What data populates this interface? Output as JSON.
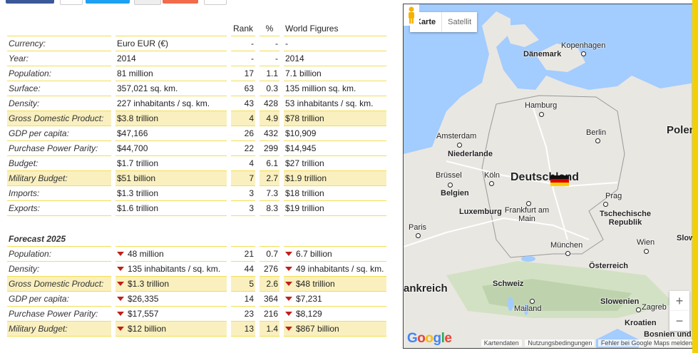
{
  "columns": {
    "rank": "Rank",
    "pct": "%",
    "world": "World Figures"
  },
  "rows": [
    {
      "label": "Currency:",
      "value": "Euro EUR (€)",
      "rank": "-",
      "pct": "-",
      "world": "-",
      "hl": false
    },
    {
      "label": "Year:",
      "value": "2014",
      "rank": "-",
      "pct": "-",
      "world": "2014",
      "hl": false
    },
    {
      "label": "Population:",
      "value": "81 million",
      "rank": "17",
      "pct": "1.1",
      "world": "7.1 billion",
      "hl": false
    },
    {
      "label": "Surface:",
      "value": "357,021 sq. km.",
      "rank": "63",
      "pct": "0.3",
      "world": "135 million sq. km.",
      "hl": false
    },
    {
      "label": "Density:",
      "value": "227 inhabitants / sq. km.",
      "rank": "43",
      "pct": "428",
      "world": "53 inhabitants / sq. km.",
      "hl": false
    },
    {
      "label": "Gross Domestic Product:",
      "value": "$3.8 trillion",
      "rank": "4",
      "pct": "4.9",
      "world": "$78 trillion",
      "hl": true
    },
    {
      "label": "GDP per capita:",
      "value": "$47,166",
      "rank": "26",
      "pct": "432",
      "world": "$10,909",
      "hl": false
    },
    {
      "label": "Purchase Power Parity:",
      "value": "$44,700",
      "rank": "22",
      "pct": "299",
      "world": "$14,945",
      "hl": false
    },
    {
      "label": "Budget:",
      "value": "$1.7 trillion",
      "rank": "4",
      "pct": "6.1",
      "world": "$27 trillion",
      "hl": false
    },
    {
      "label": "Military Budget:",
      "value": "$51 billion",
      "rank": "7",
      "pct": "2.7",
      "world": "$1.9 trillion",
      "hl": true
    },
    {
      "label": "Imports:",
      "value": "$1.3 trillion",
      "rank": "3",
      "pct": "7.3",
      "world": "$18 trillion",
      "hl": false
    },
    {
      "label": "Exports:",
      "value": "$1.6 trillion",
      "rank": "3",
      "pct": "8.3",
      "world": "$19 trillion",
      "hl": false
    }
  ],
  "forecast_title": "Forecast 2025",
  "forecast": [
    {
      "label": "Population:",
      "value": "48 million",
      "rank": "21",
      "pct": "0.7",
      "world": "6.7 billion",
      "hl": false
    },
    {
      "label": "Density:",
      "value": "135 inhabitants / sq. km.",
      "rank": "44",
      "pct": "276",
      "world": "49 inhabitants / sq. km.",
      "hl": false
    },
    {
      "label": "Gross Domestic Product:",
      "value": "$1.3 trillion",
      "rank": "5",
      "pct": "2.6",
      "world": "$48 trillion",
      "hl": true
    },
    {
      "label": "GDP per capita:",
      "value": "$26,335",
      "rank": "14",
      "pct": "364",
      "world": "$7,231",
      "hl": false
    },
    {
      "label": "Purchase Power Parity:",
      "value": "$17,557",
      "rank": "23",
      "pct": "216",
      "world": "$8,129",
      "hl": false
    },
    {
      "label": "Military Budget:",
      "value": "$12 billion",
      "rank": "13",
      "pct": "1.4",
      "world": "$867 billion",
      "hl": true
    }
  ],
  "map": {
    "type_active": "Karte",
    "type_inactive": "Satellit",
    "country_main": "Deutschland",
    "labels": {
      "kopenhagen": "Kopenhagen",
      "daenemark": "Dänemark",
      "hamburg": "Hamburg",
      "berlin": "Berlin",
      "polen": "Polen",
      "amsterdam": "Amsterdam",
      "niederlande": "Niederlande",
      "bruessel": "Brüssel",
      "belgien": "Belgien",
      "koeln": "Köln",
      "luxemburg": "Luxemburg",
      "frankfurt": "Frankfurt am Main",
      "prag": "Prag",
      "tschechien": "Tschechische Republik",
      "paris": "Paris",
      "muenchen": "München",
      "wien": "Wien",
      "slow": "Slow",
      "oesterreich": "Österreich",
      "frankreich": "ankreich",
      "schweiz": "Schweiz",
      "mailand": "Mailand",
      "slowenien": "Slowenien",
      "zagreb": "Zagreb",
      "kroatien": "Kroatien",
      "bosnien": "Bosnien und"
    },
    "zoom_in": "+",
    "zoom_out": "−",
    "footer": {
      "kartendaten": "Kartendaten",
      "nutzung": "Nutzungsbedingungen",
      "fehler": "Fehler bei Google Maps melden"
    },
    "logo": "Google"
  },
  "colors": {
    "highlight": "#faf0bf",
    "rule": "#f3de50",
    "arrow": "#c0201a",
    "water": "#a3ccff"
  }
}
